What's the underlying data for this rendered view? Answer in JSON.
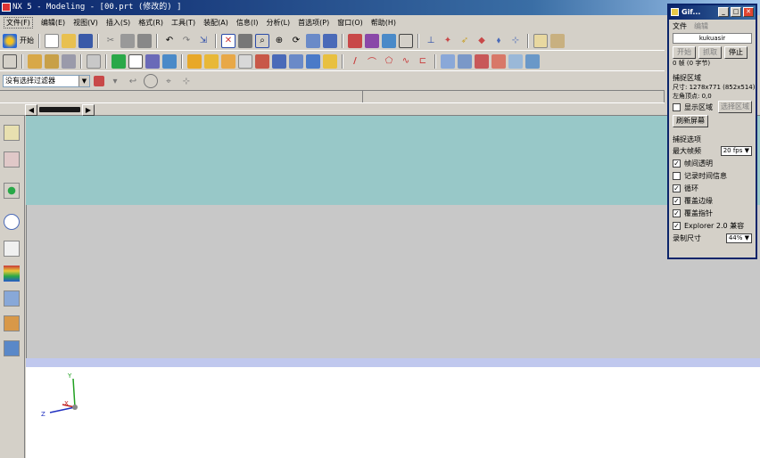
{
  "window": {
    "title": "NX 5 - Modeling - [00.prt  (修改的)  ]"
  },
  "menu": [
    "文件(F)",
    "编辑(E)",
    "视图(V)",
    "插入(S)",
    "格式(R)",
    "工具(T)",
    "装配(A)",
    "信息(I)",
    "分析(L)",
    "首选项(P)",
    "窗口(O)",
    "帮助(H)"
  ],
  "toolbar1": {
    "start_label": "开始"
  },
  "filterbar": {
    "selection_filter": "没有选择过滤器"
  },
  "gif": {
    "title": "Gif...",
    "menu": [
      "文件",
      "编辑"
    ],
    "user": "kukuasir",
    "buttons": {
      "start": "开始",
      "capture": "抓取",
      "stop": "停止"
    },
    "frames": "0 帧 (0 字节)",
    "capture_area_heading": "捕捉区域",
    "size": "尺寸: 1278x771 (852x514)",
    "top_left": "左角顶点:       0,0",
    "show_area": "显示区域",
    "select_area": "选择区域",
    "refresh": "刷新屏幕",
    "options_heading": "捕捉选项",
    "max_fps_label": "最大帧频",
    "max_fps": "20 fps",
    "opt_transparent": "帧间透明",
    "opt_record_time": "记录时间信息",
    "opt_loop": "循环",
    "opt_cover_border": "覆盖边缘",
    "opt_cover_cursor": "覆盖指针",
    "opt_explorer": "Explorer 2.0 兼容",
    "record_size_label": "录制尺寸",
    "record_size": "44%",
    "checks": {
      "transparent": true,
      "record_time": false,
      "loop": true,
      "cover_border": true,
      "cover_cursor": true,
      "explorer": true,
      "show_area": false
    }
  },
  "axes": {
    "x": "X",
    "y": "Y",
    "z": "Z"
  }
}
